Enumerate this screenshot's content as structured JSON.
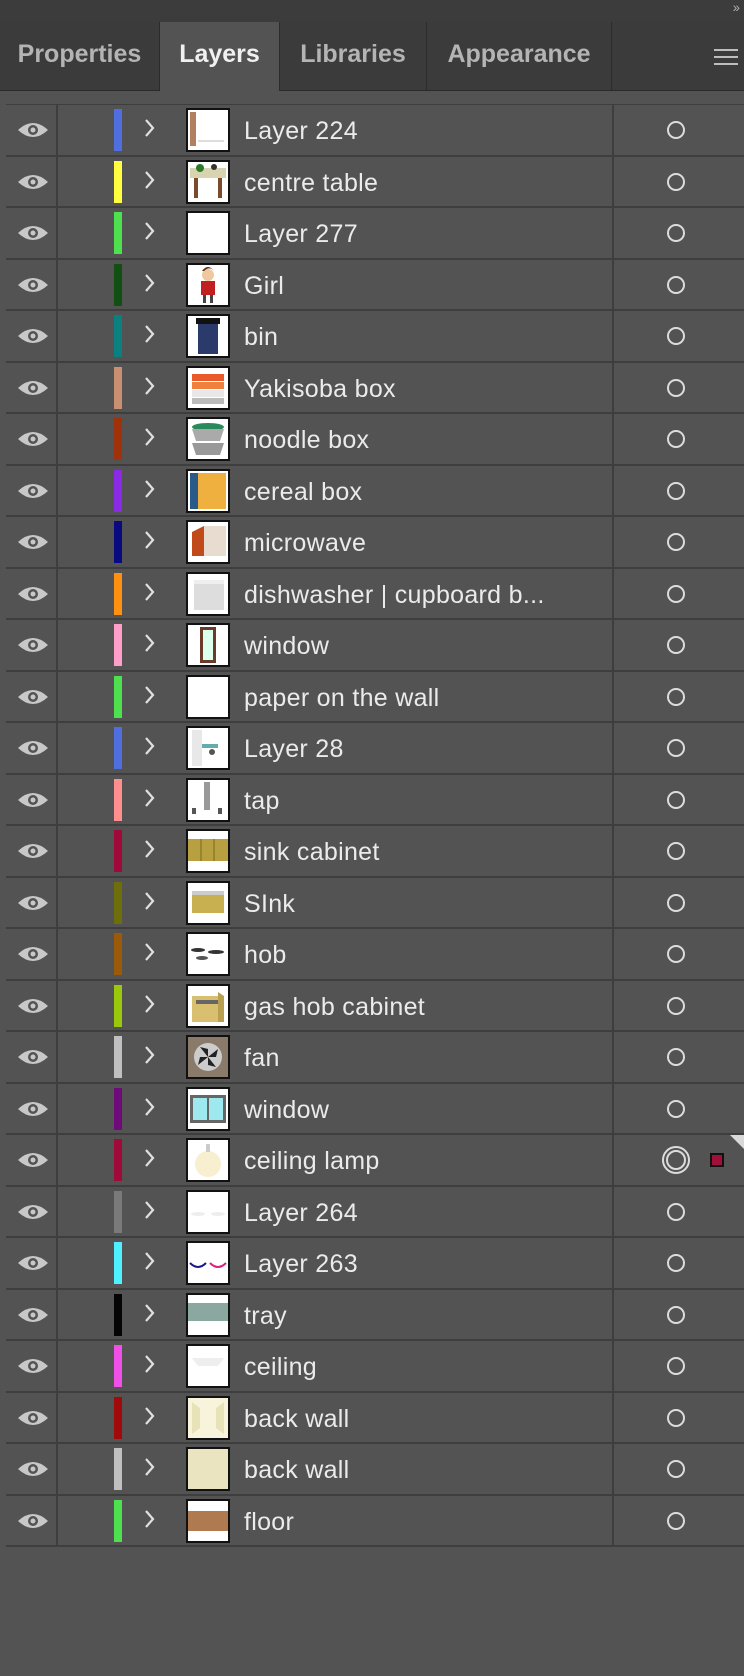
{
  "panel": {
    "collapse_icon": "double-chevron-right-icon",
    "menu_icon": "hamburger-menu-icon",
    "tabs": [
      {
        "label": "Properties",
        "active": false
      },
      {
        "label": "Layers",
        "active": true
      },
      {
        "label": "Libraries",
        "active": false
      },
      {
        "label": "Appearance",
        "active": false
      }
    ]
  },
  "layers": [
    {
      "name": "Layer 224",
      "color": "#4f6fe0",
      "thumb": "layer224"
    },
    {
      "name": "centre table",
      "color": "#ffff40",
      "thumb": "table"
    },
    {
      "name": "Layer 277",
      "color": "#4fe04f",
      "thumb": "blank"
    },
    {
      "name": "Girl",
      "color": "#124f12",
      "thumb": "girl"
    },
    {
      "name": "bin",
      "color": "#0a8080",
      "thumb": "bin"
    },
    {
      "name": "Yakisoba box",
      "color": "#c89070",
      "thumb": "yakisoba"
    },
    {
      "name": "noodle box",
      "color": "#a0320a",
      "thumb": "noodle"
    },
    {
      "name": "cereal box",
      "color": "#8a2ae6",
      "thumb": "cereal"
    },
    {
      "name": "microwave",
      "color": "#0a0a80",
      "thumb": "microwave"
    },
    {
      "name": "dishwasher | cupboard b...",
      "color": "#ff9010",
      "thumb": "dishwasher"
    },
    {
      "name": "window",
      "color": "#ff9ec8",
      "thumb": "window1"
    },
    {
      "name": "paper on the wall",
      "color": "#4fe04f",
      "thumb": "blank"
    },
    {
      "name": "Layer 28",
      "color": "#4f6fe0",
      "thumb": "layer28"
    },
    {
      "name": "tap",
      "color": "#ff8f8f",
      "thumb": "tap"
    },
    {
      "name": "sink cabinet",
      "color": "#a00a3a",
      "thumb": "sinkcab"
    },
    {
      "name": "SInk",
      "color": "#6e6e0a",
      "thumb": "sink"
    },
    {
      "name": "hob",
      "color": "#9a5a0a",
      "thumb": "hob"
    },
    {
      "name": "gas hob cabinet",
      "color": "#9ac80a",
      "thumb": "gascab"
    },
    {
      "name": "fan",
      "color": "#c0c0c0",
      "thumb": "fan"
    },
    {
      "name": "window",
      "color": "#6e0a7a",
      "thumb": "window2"
    },
    {
      "name": "ceiling lamp",
      "color": "#a00a3a",
      "thumb": "lamp",
      "selected": true
    },
    {
      "name": "Layer 264",
      "color": "#7a7a7a",
      "thumb": "l264"
    },
    {
      "name": "Layer 263",
      "color": "#4ff0ff",
      "thumb": "l263"
    },
    {
      "name": "tray",
      "color": "#050505",
      "thumb": "tray"
    },
    {
      "name": "ceiling",
      "color": "#f04fe8",
      "thumb": "ceiling"
    },
    {
      "name": "back wall",
      "color": "#a00a0a",
      "thumb": "backwall1"
    },
    {
      "name": "back wall",
      "color": "#c0c0c0",
      "thumb": "backwall2"
    },
    {
      "name": "floor",
      "color": "#4fe04f",
      "thumb": "floor"
    }
  ],
  "row_icons": {
    "visibility": "eye-icon",
    "expand": "chevron-right-icon",
    "target": "target-circle-icon"
  }
}
